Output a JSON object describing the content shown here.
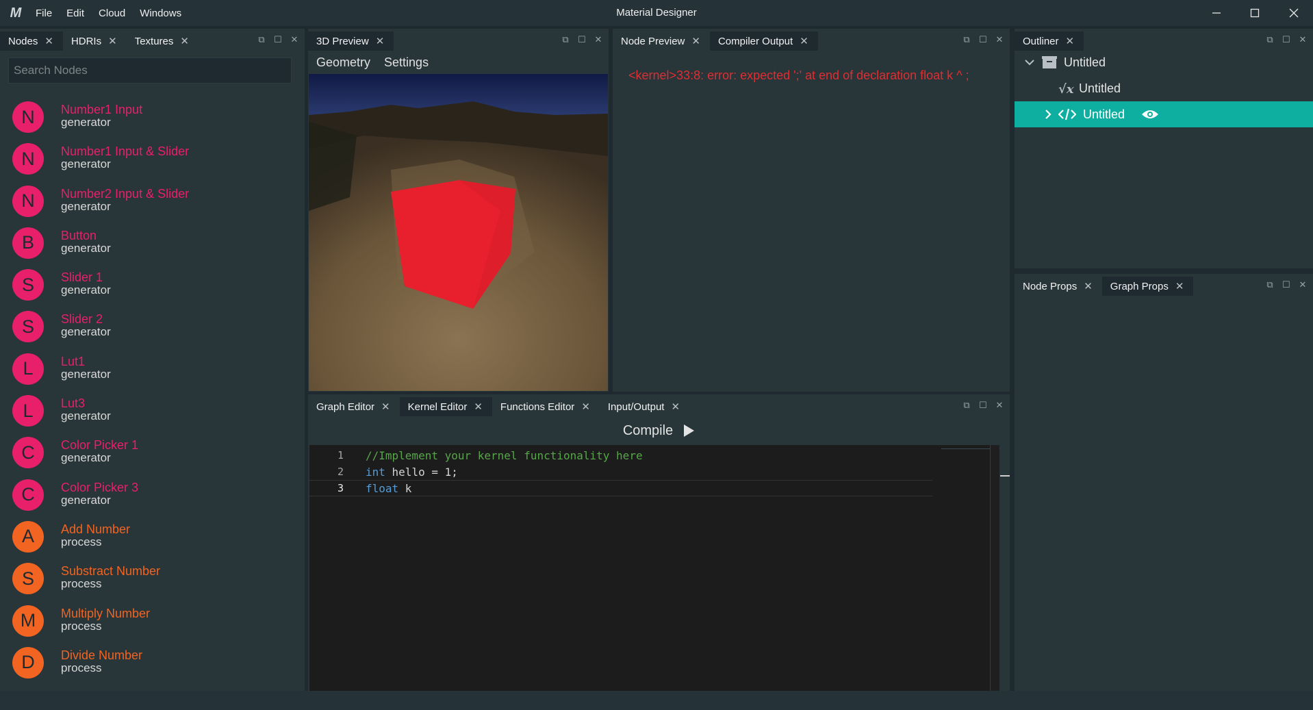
{
  "app": {
    "logo": "M",
    "title": "Material Designer"
  },
  "menu": [
    "File",
    "Edit",
    "Cloud",
    "Windows"
  ],
  "window_controls": {
    "minimize": "—",
    "maximize": "☐",
    "close": "✕"
  },
  "panel_controls": {
    "float": "⧉",
    "maximize": "☐",
    "close": "✕"
  },
  "nodes_panel": {
    "tabs": [
      {
        "label": "Nodes"
      },
      {
        "label": "HDRIs"
      },
      {
        "label": "Textures"
      }
    ],
    "search_placeholder": "Search Nodes",
    "items": [
      {
        "letter": "N",
        "name": "Number1 Input",
        "category": "generator",
        "color": "#e8206a"
      },
      {
        "letter": "N",
        "name": "Number1 Input & Slider",
        "category": "generator",
        "color": "#e8206a"
      },
      {
        "letter": "N",
        "name": "Number2 Input & Slider",
        "category": "generator",
        "color": "#e8206a"
      },
      {
        "letter": "B",
        "name": "Button",
        "category": "generator",
        "color": "#e8206a"
      },
      {
        "letter": "S",
        "name": "Slider 1",
        "category": "generator",
        "color": "#e8206a"
      },
      {
        "letter": "S",
        "name": "Slider 2",
        "category": "generator",
        "color": "#e8206a"
      },
      {
        "letter": "L",
        "name": "Lut1",
        "category": "generator",
        "color": "#e8206a"
      },
      {
        "letter": "L",
        "name": "Lut3",
        "category": "generator",
        "color": "#e8206a"
      },
      {
        "letter": "C",
        "name": "Color Picker 1",
        "category": "generator",
        "color": "#e8206a"
      },
      {
        "letter": "C",
        "name": "Color Picker 3",
        "category": "generator",
        "color": "#e8206a"
      },
      {
        "letter": "A",
        "name": "Add Number",
        "category": "process",
        "color": "#f26421"
      },
      {
        "letter": "S",
        "name": "Substract Number",
        "category": "process",
        "color": "#f26421"
      },
      {
        "letter": "M",
        "name": "Multiply Number",
        "category": "process",
        "color": "#f26421"
      },
      {
        "letter": "D",
        "name": "Divide Number",
        "category": "process",
        "color": "#f26421"
      }
    ]
  },
  "preview_panel": {
    "tab": "3D Preview",
    "subtabs": [
      "Geometry",
      "Settings"
    ]
  },
  "compiler_panel": {
    "tabs": [
      {
        "label": "Node Preview"
      },
      {
        "label": "Compiler Output"
      }
    ],
    "error": "<kernel>33:8: error: expected ';' at end of declaration float k ^ ;"
  },
  "editor_panel": {
    "tabs": [
      {
        "label": "Graph Editor"
      },
      {
        "label": "Kernel Editor"
      },
      {
        "label": "Functions Editor"
      },
      {
        "label": "Input/Output"
      }
    ],
    "compile_label": "Compile",
    "lines": [
      {
        "num": "1",
        "text": "//Implement your kernel functionality here"
      },
      {
        "num": "2",
        "keyword": "int",
        "rest": " hello = 1;"
      },
      {
        "num": "3",
        "keyword": "float",
        "rest": " k"
      }
    ]
  },
  "outliner": {
    "tab": "Outliner",
    "rows": [
      {
        "label": "Untitled",
        "icon": "folder-icon"
      },
      {
        "label": "Untitled",
        "icon": "function-icon"
      },
      {
        "label": "Untitled",
        "icon": "code-icon",
        "selected": true
      }
    ]
  },
  "props_panel": {
    "tabs": [
      {
        "label": "Node Props"
      },
      {
        "label": "Graph Props"
      }
    ]
  },
  "colors": {
    "accent": "#0eaea0",
    "generator": "#e8206a",
    "process": "#f26421",
    "error": "#e12d31",
    "bg": "#283539"
  }
}
